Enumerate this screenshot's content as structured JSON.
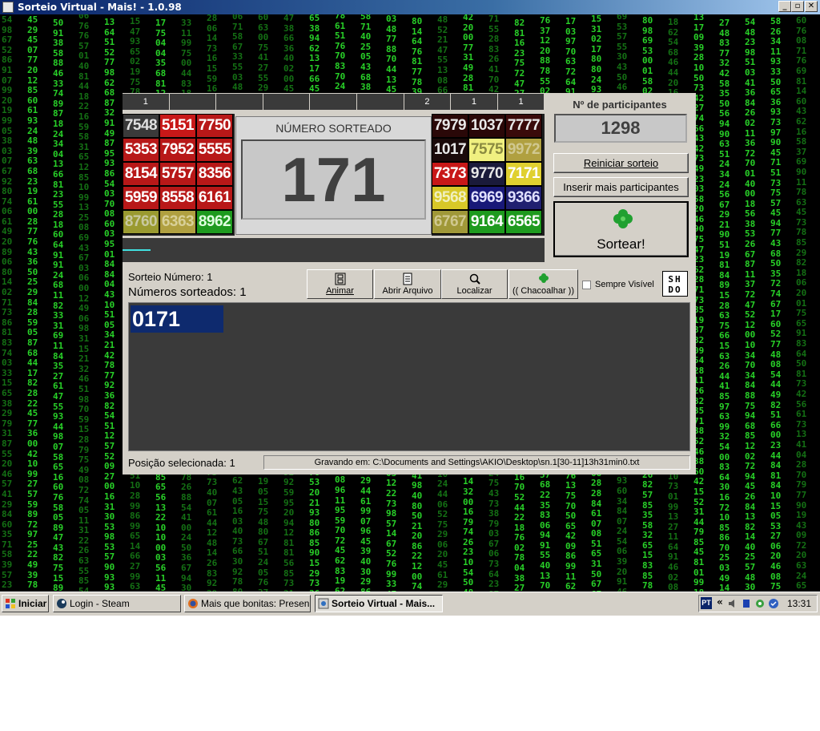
{
  "window": {
    "title": "Sorteio Virtual - Mais! - 1.0.98"
  },
  "header_counts": [
    "1",
    "",
    "",
    "",
    "",
    "",
    "2",
    "1",
    "1"
  ],
  "tiles_left": [
    {
      "v": "7548",
      "bg": "#3a3a3a",
      "fg": "#e0e0e0"
    },
    {
      "v": "5151",
      "bg": "#c81818",
      "fg": "#ffffff"
    },
    {
      "v": "7750",
      "bg": "#b81818",
      "fg": "#ffffff"
    },
    {
      "v": "5353",
      "bg": "#b81818",
      "fg": "#ffffff"
    },
    {
      "v": "7952",
      "bg": "#b81818",
      "fg": "#ffffff"
    },
    {
      "v": "5555",
      "bg": "#b81818",
      "fg": "#ffffff"
    },
    {
      "v": "8154",
      "bg": "#b81818",
      "fg": "#ffffff"
    },
    {
      "v": "5757",
      "bg": "#b81818",
      "fg": "#ffffff"
    },
    {
      "v": "8356",
      "bg": "#b81818",
      "fg": "#ffffff"
    },
    {
      "v": "5959",
      "bg": "#b81818",
      "fg": "#ffffff"
    },
    {
      "v": "8558",
      "bg": "#b81818",
      "fg": "#ffffff"
    },
    {
      "v": "6161",
      "bg": "#b81818",
      "fg": "#ffffff"
    },
    {
      "v": "8760",
      "bg": "#9a9a30",
      "fg": "#c8c8a0"
    },
    {
      "v": "6363",
      "bg": "#b0a040",
      "fg": "#d8d098"
    },
    {
      "v": "8962",
      "bg": "#1e9a1e",
      "fg": "#e0ffe0"
    }
  ],
  "tiles_right": [
    {
      "v": "7979",
      "bg": "#2a0808",
      "fg": "#e8e8e8"
    },
    {
      "v": "1037",
      "bg": "#2a0808",
      "fg": "#e8e8e8"
    },
    {
      "v": "7777",
      "bg": "#3a0a0a",
      "fg": "#e8e8e8"
    },
    {
      "v": "1017",
      "bg": "#1a0a0a",
      "fg": "#e8e8e8"
    },
    {
      "v": "7575",
      "bg": "#f0f080",
      "fg": "#8a8a40"
    },
    {
      "v": "9972",
      "bg": "#b0a040",
      "fg": "#d0c890"
    },
    {
      "v": "7373",
      "bg": "#c81818",
      "fg": "#ffffff"
    },
    {
      "v": "9770",
      "bg": "#1a1a3a",
      "fg": "#e8e8e8"
    },
    {
      "v": "7171",
      "bg": "#e0d030",
      "fg": "#ffffff"
    },
    {
      "v": "9568",
      "bg": "#d8c828",
      "fg": "#f0f0c0"
    },
    {
      "v": "6969",
      "bg": "#181878",
      "fg": "#e0e0ff"
    },
    {
      "v": "9366",
      "bg": "#202070",
      "fg": "#e0e0ff"
    },
    {
      "v": "6767",
      "bg": "#a09838",
      "fg": "#d0c890"
    },
    {
      "v": "9164",
      "bg": "#1e9a1e",
      "fg": "#ffffff"
    },
    {
      "v": "6565",
      "bg": "#1e9a1e",
      "fg": "#ffffff"
    }
  ],
  "sorteado": {
    "label": "NÚMERO SORTEADO",
    "value": "171"
  },
  "participants": {
    "label": "Nº de participantes",
    "value": "1298"
  },
  "buttons": {
    "reiniciar": "Reiniciar sorteio",
    "inserir": "Inserir mais participantes",
    "sortear": "Sortear!"
  },
  "info": {
    "sorteio_numero": "Sorteio Número: 1",
    "numeros_sorteados": "Números sorteados: 1"
  },
  "toolbar": {
    "animar": "Animar",
    "abrir": "Abrir Arquivo",
    "localizar": "Localizar",
    "chacoalhar": "(( Chacoalhar ))",
    "sempre_visivel": "Sempre Visível"
  },
  "logo_text": "SH DO",
  "results": [
    "0171"
  ],
  "status": {
    "posicao": "Posição selecionada: 1",
    "gravando": "Gravando em: C:\\Documents and Settings\\AKIO\\Desktop\\sn.1[30-11]13h31min0.txt"
  },
  "taskbar": {
    "start": "Iniciar",
    "items": [
      "Login - Steam",
      "Mais que bonitas: Presen...",
      "Sorteio Virtual - Mais..."
    ],
    "lang": "PT",
    "clock": "13:31"
  },
  "colors": {
    "accent": "#0e2a6e",
    "matrix_green": "#20c020",
    "title_blue": "#0a246a"
  }
}
